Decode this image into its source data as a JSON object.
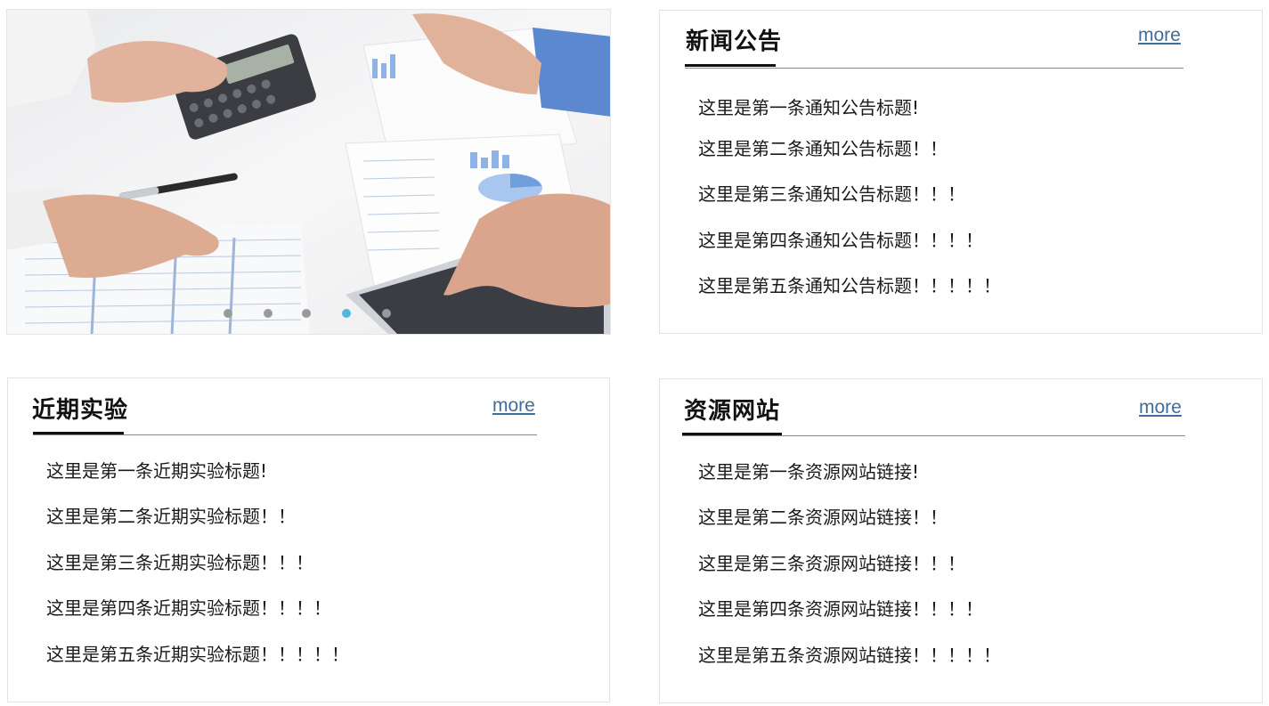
{
  "carousel": {
    "slides_count": 5,
    "active_index": 3,
    "image": "business-charts-calculator-photo",
    "dot_color": "#9a9a9a",
    "active_dot_color": "#4fb8d6"
  },
  "news": {
    "title": "新闻公告",
    "more_label": "more",
    "items": [
      "这里是第一条通知公告标题!",
      "这里是第二条通知公告标题！！",
      "这里是第三条通知公告标题！！！",
      "这里是第四条通知公告标题！！！！",
      "这里是第五条通知公告标题！！！！！"
    ]
  },
  "experiments": {
    "title": "近期实验",
    "more_label": "more",
    "items": [
      "这里是第一条近期实验标题!",
      "这里是第二条近期实验标题！！",
      "这里是第三条近期实验标题！！！",
      "这里是第四条近期实验标题！！！！",
      "这里是第五条近期实验标题！！！！！"
    ]
  },
  "resources": {
    "title": "资源网站",
    "more_label": "more",
    "items": [
      "这里是第一条资源网站链接!",
      "这里是第二条资源网站链接！！",
      "这里是第三条资源网站链接！！！",
      "这里是第四条资源网站链接！！！！",
      "这里是第五条资源网站链接！！！！！"
    ]
  },
  "colors": {
    "link": "#3e6d9c",
    "title": "#111111",
    "rule": "#8a8a8a"
  }
}
